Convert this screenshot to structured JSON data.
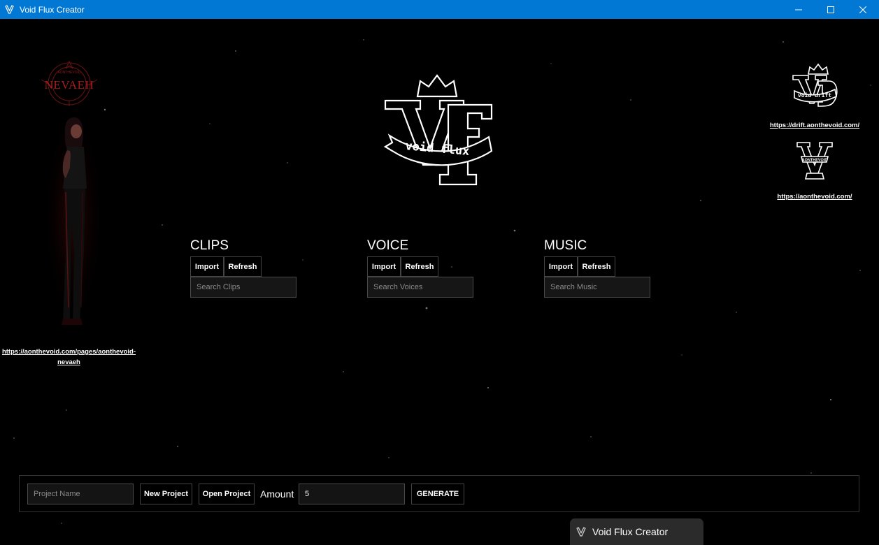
{
  "window": {
    "title": "Void Flux Creator",
    "titlebar_color": "#0078d4"
  },
  "left_panel": {
    "logo_text": "NEVAEH",
    "logo_subtext": "AONTHEVOID",
    "link": "https://aonthevoid.com/pages/aonthevoid-nevaeh"
  },
  "main_logo": {
    "text": "void flux",
    "letters": "VF"
  },
  "right_panel": {
    "vd_logo_text": "void drift",
    "vd_link": "https://drift.aonthevoid.com/",
    "v_logo_text": "AONTHEVOID",
    "v_link": "https://aonthevoid.com/"
  },
  "sections": [
    {
      "title": "CLIPS",
      "import_label": "Import",
      "refresh_label": "Refresh",
      "search_placeholder": "Search Clips"
    },
    {
      "title": "VOICE",
      "import_label": "Import",
      "refresh_label": "Refresh",
      "search_placeholder": "Search Voices"
    },
    {
      "title": "MUSIC",
      "import_label": "Import",
      "refresh_label": "Refresh",
      "search_placeholder": "Search Music"
    }
  ],
  "bottom_bar": {
    "project_name_placeholder": "Project Name",
    "new_project_label": "New Project",
    "open_project_label": "Open Project",
    "amount_label": "Amount",
    "amount_value": "5",
    "generate_label": "GENERATE"
  },
  "taskbar_preview": {
    "label": "Void Flux Creator"
  }
}
